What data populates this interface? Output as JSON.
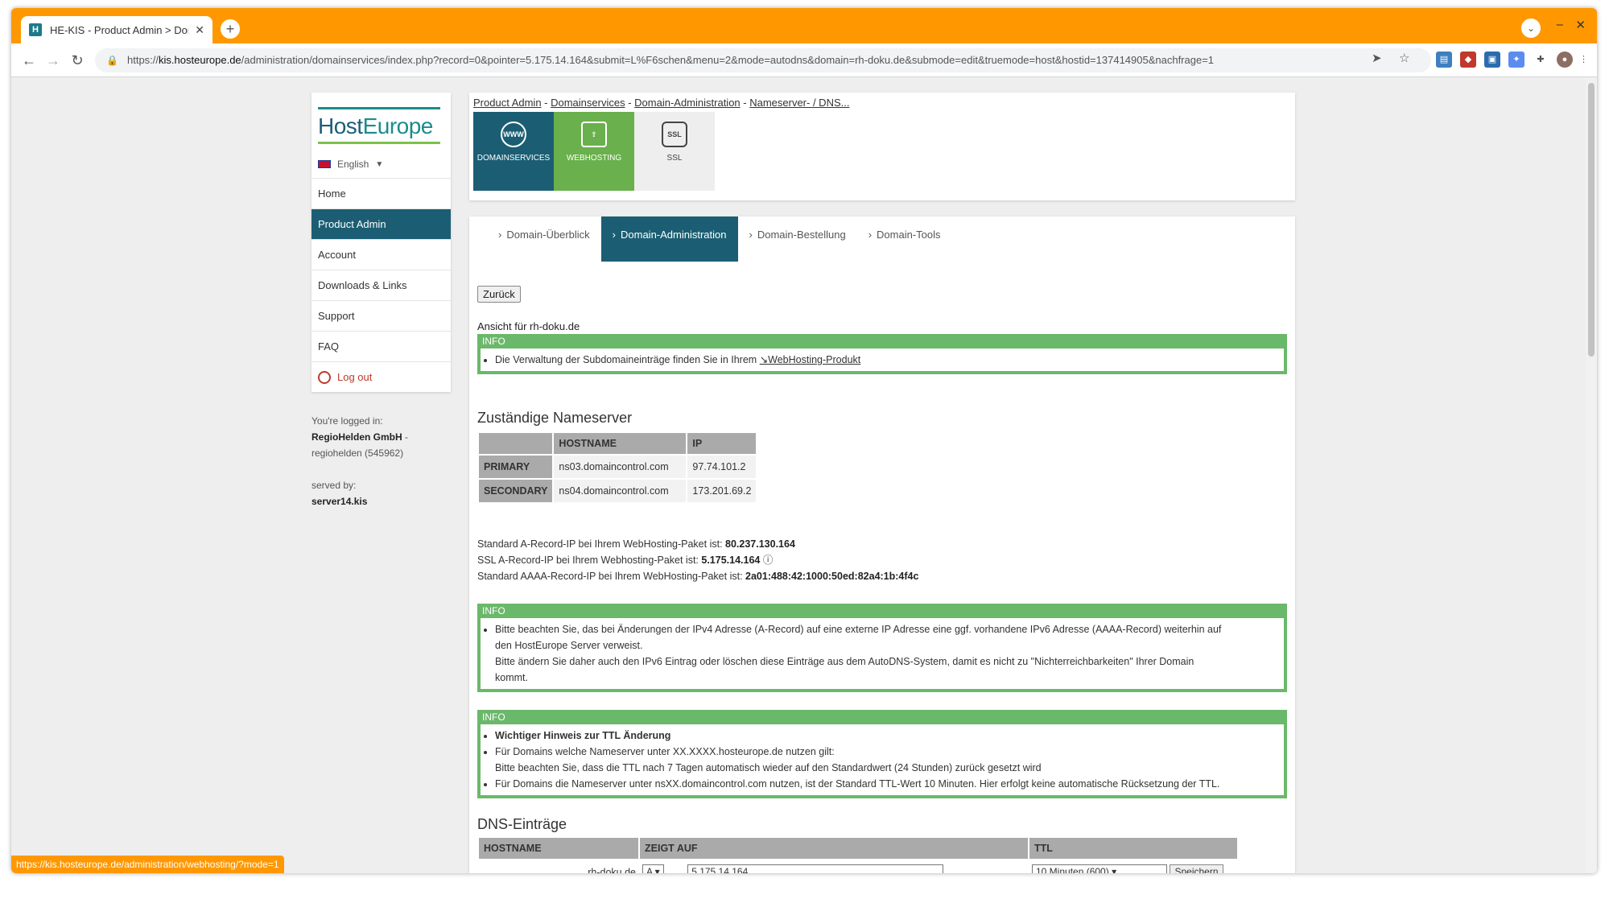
{
  "browser": {
    "tab_title": "HE-KIS - Product Admin > Dom",
    "tab_favicon": "H",
    "url_domain": "kis.hosteurope.de",
    "url_prefix": "https://",
    "url_path": "/administration/domainservices/index.php?record=0&pointer=5.175.14.164&submit=L%F6schen&menu=2&mode=autodns&domain=rh-doku.de&submode=edit&truemode=host&hostid=137414905&nachfrage=1",
    "status_url": "https://kis.hosteurope.de/administration/webhosting/?mode=1",
    "accent_color": "#ff9800"
  },
  "sidebar": {
    "logo_left": "Host",
    "logo_right": "Europe",
    "language": "English",
    "items": [
      {
        "label": "Home"
      },
      {
        "label": "Product Admin"
      },
      {
        "label": "Account"
      },
      {
        "label": "Downloads & Links"
      },
      {
        "label": "Support"
      },
      {
        "label": "FAQ"
      }
    ],
    "logout": "Log out",
    "logged_in_label": "You're logged in:",
    "company": "RegioHelden GmbH",
    "company_suffix": " -",
    "user": "regiohelden (545962)",
    "served_label": "served by:",
    "server": "server14.kis"
  },
  "breadcrumb": {
    "items": [
      "Product Admin",
      "Domainservices",
      "Domain-Administration",
      "Nameserver- / DNS..."
    ],
    "sep": " - "
  },
  "tiles": [
    {
      "label": "DOMAINSERVICES",
      "icon": "www-globe-icon",
      "glyph": "WWW"
    },
    {
      "label": "WEBHOSTING",
      "icon": "upload-screen-icon",
      "glyph": "⇪"
    },
    {
      "label": "SSL",
      "icon": "ssl-shield-icon",
      "glyph": "SSL"
    }
  ],
  "subtabs": [
    "Domain-Überblick",
    "Domain-Administration",
    "Domain-Bestellung",
    "Domain-Tools"
  ],
  "back_button": "Zurück",
  "view_for": "Ansicht für rh-doku.de",
  "info1": {
    "head": "INFO",
    "text": "Die Verwaltung der Subdomaineinträge finden Sie in Ihrem ",
    "link": "↘WebHosting-Produkt"
  },
  "nameserver": {
    "title": "Zuständige Nameserver",
    "headers": [
      "",
      "HOSTNAME",
      "IP"
    ],
    "rows": [
      {
        "type": "PRIMARY",
        "host": "ns03.domaincontrol.com",
        "ip": "97.74.101.2"
      },
      {
        "type": "SECONDARY",
        "host": "ns04.domaincontrol.com",
        "ip": "173.201.69.2"
      }
    ]
  },
  "arecords": {
    "l1": "Standard A-Record-IP bei Ihrem WebHosting-Paket ist: ",
    "v1": "80.237.130.164",
    "l2": "SSL A-Record-IP bei Ihrem Webhosting-Paket ist: ",
    "v2": "5.175.14.164",
    "l3": "Standard AAAA-Record-IP bei Ihrem WebHosting-Paket ist: ",
    "v3": "2a01:488:42:1000:50ed:82a4:1b:4f4c"
  },
  "info2": {
    "head": "INFO",
    "l1": "Bitte beachten Sie, das bei Änderungen der IPv4 Adresse (A-Record) auf eine externe IP Adresse eine ggf. vorhandene IPv6 Adresse (AAAA-Record) weiterhin auf",
    "l2": "den HostEurope Server verweist.",
    "l3": "Bitte ändern Sie daher auch den IPv6 Eintrag oder löschen diese Einträge aus dem AutoDNS-System, damit es nicht zu \"Nichterreichbarkeiten\" Ihrer Domain",
    "l4": "kommt."
  },
  "info3": {
    "head": "INFO",
    "title": "Wichtiger Hinweis zur TTL Änderung",
    "l1": "Für Domains welche Nameserver unter XX.XXXX.hosteurope.de nutzen gilt:",
    "l2": "Bitte beachten Sie, dass die TTL nach 7 Tagen automatisch wieder auf den Standardwert (24 Stunden) zurück gesetzt wird",
    "l3": "Für Domains die Nameserver unter nsXX.domaincontrol.com nutzen, ist der Standard TTL-Wert 10 Minuten. Hier erfolgt keine automatische Rücksetzung der TTL."
  },
  "dns": {
    "title": "DNS-Einträge",
    "headers": [
      "HOSTNAME",
      "ZEIGT AUF",
      "TTL"
    ],
    "row": {
      "host": ".rh-doku.de",
      "type": "A",
      "value": "5.175.14.164",
      "ttl": "10 Minuten (600)",
      "save": "Speichern"
    }
  }
}
